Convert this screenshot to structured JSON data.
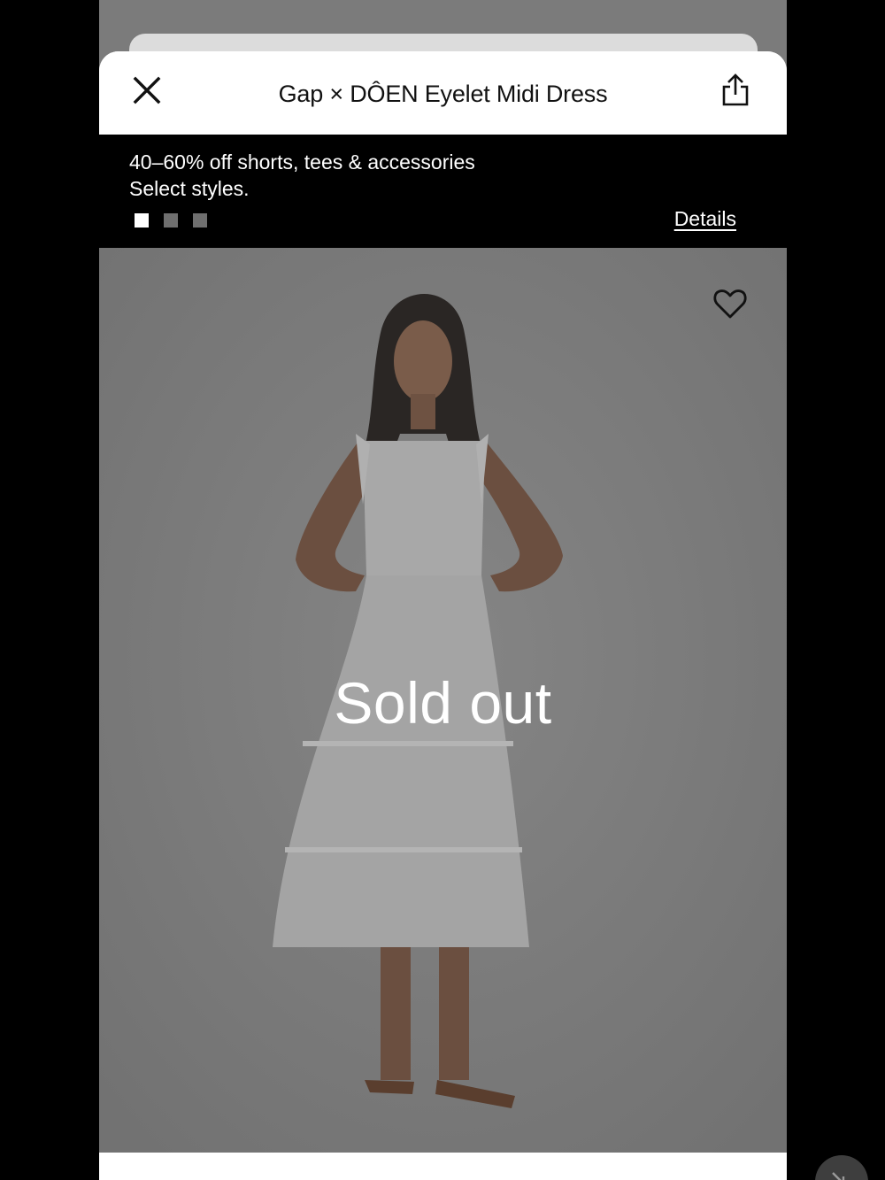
{
  "header": {
    "title": "Gap × DÔEN Eyelet Midi Dress",
    "close_icon": "close-icon",
    "share_icon": "share-icon"
  },
  "promo": {
    "line1": "40–60% off shorts, tees & accessories",
    "line2": "Select styles.",
    "details_label": "Details",
    "carousel_count": 3,
    "carousel_active_index": 0
  },
  "product": {
    "status_label": "Sold out",
    "wishlist_icon": "heart-icon"
  },
  "colors": {
    "promo_bg": "#000000",
    "overlay": "#7a7a7a",
    "text_on_dark": "#ffffff"
  }
}
